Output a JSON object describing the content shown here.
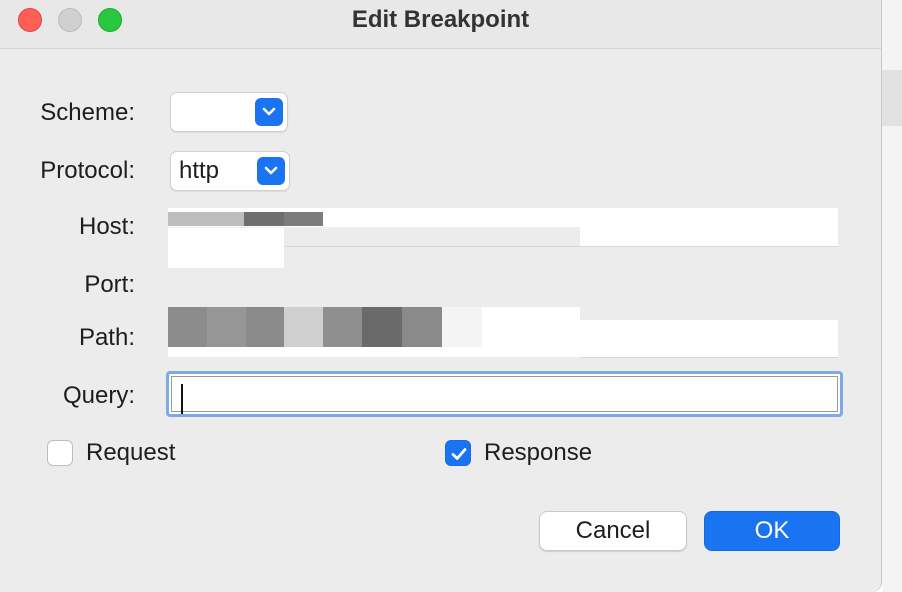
{
  "window": {
    "title": "Edit Breakpoint"
  },
  "form": {
    "scheme": {
      "label": "Scheme:",
      "value": ""
    },
    "protocol": {
      "label": "Protocol:",
      "value": "http"
    },
    "host": {
      "label": "Host:"
    },
    "port": {
      "label": "Port:"
    },
    "path": {
      "label": "Path:"
    },
    "query": {
      "label": "Query:",
      "value": ""
    }
  },
  "options": {
    "request": {
      "label": "Request",
      "checked": false
    },
    "response": {
      "label": "Response",
      "checked": true
    }
  },
  "buttons": {
    "cancel": "Cancel",
    "ok": "OK"
  },
  "colors": {
    "accent": "#1a73f0",
    "close": "#fe5f57",
    "zoom": "#28c840"
  }
}
